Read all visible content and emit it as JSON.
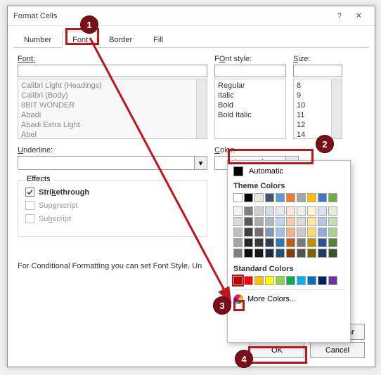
{
  "dialogTitle": "Format Cells",
  "tabs": {
    "number": "Number",
    "font": "Font",
    "border": "Border",
    "fill": "Fill"
  },
  "labels": {
    "font": "Font:",
    "fontStyle": "Font style:",
    "fontStyleAcc": "O",
    "size": "Size:",
    "sizeAcc": "S",
    "underline": "Underline:",
    "underlineAcc": "U",
    "color": "Color:",
    "colorAcc": "C",
    "effects": "Effects"
  },
  "fontList": [
    "Calibri Light (Headings)",
    "Calibri (Body)",
    "8BIT WONDER",
    "Abadi",
    "Abadi Extra Light",
    "Abel"
  ],
  "styleList": [
    "Regular",
    "Italic",
    "Bold",
    "Bold Italic"
  ],
  "sizeList": [
    "8",
    "9",
    "10",
    "11",
    "12",
    "14"
  ],
  "colorCombo": "Automatic",
  "effects": {
    "strike": "Strikethrough",
    "super": "Superscript",
    "sub": "Subscript"
  },
  "checkbox": {
    "strike": true,
    "super": false,
    "sub": false
  },
  "note": "For Conditional Formatting you can set Font Style, Un",
  "popup": {
    "automatic": "Automatic",
    "themeHead": "Theme Colors",
    "stdHead": "Standard Colors",
    "more": "More Colors...",
    "moreAcc": "M"
  },
  "buttons": {
    "ok": "OK",
    "cancel": "Cancel",
    "clear": "Clear"
  },
  "markers": {
    "m1": "1",
    "m2": "2",
    "m3": "3",
    "m4": "4"
  },
  "themeRow1": [
    "#ffffff",
    "#000000",
    "#e7e6e6",
    "#44546a",
    "#5b9bd5",
    "#ed7d31",
    "#a5a5a5",
    "#ffc000",
    "#4472c4",
    "#70ad47"
  ],
  "themeShades": [
    [
      "#f2f2f2",
      "#7f7f7f",
      "#d0cece",
      "#d6dce5",
      "#deebf7",
      "#fbe5d6",
      "#ededed",
      "#fff2cc",
      "#d9e2f3",
      "#e2efda"
    ],
    [
      "#d9d9d9",
      "#595959",
      "#aeabab",
      "#adb9ca",
      "#bdd7ee",
      "#f7cbac",
      "#dbdbdb",
      "#ffe699",
      "#b4c7e7",
      "#c5e0b4"
    ],
    [
      "#bfbfbf",
      "#3f3f3f",
      "#757070",
      "#8497b0",
      "#9cc3e6",
      "#f4b183",
      "#c9c9c9",
      "#ffd966",
      "#8faadc",
      "#a9d18e"
    ],
    [
      "#a5a5a5",
      "#262626",
      "#3a3838",
      "#323f4f",
      "#2e75b6",
      "#c55a11",
      "#7b7b7b",
      "#bf9000",
      "#2f5597",
      "#548235"
    ],
    [
      "#7f7f7f",
      "#0d0d0d",
      "#171616",
      "#222a35",
      "#1e4e79",
      "#833c0c",
      "#525252",
      "#7f6000",
      "#1f3864",
      "#375623"
    ]
  ],
  "standardColors": [
    "#c00000",
    "#ff0000",
    "#ffc000",
    "#ffff00",
    "#92d050",
    "#00b050",
    "#00b0f0",
    "#0070c0",
    "#002060",
    "#7030a0"
  ]
}
